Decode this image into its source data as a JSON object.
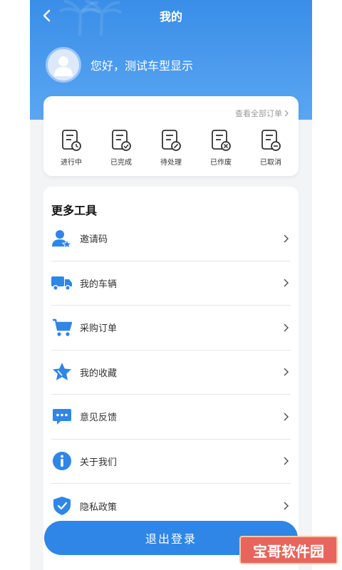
{
  "nav": {
    "title": "我的"
  },
  "profile": {
    "greeting": "您好，测试车型显示"
  },
  "orders": {
    "view_all": "查看全部订单",
    "items": [
      {
        "label": "进行中",
        "icon": "order-in-progress-icon"
      },
      {
        "label": "已完成",
        "icon": "order-completed-icon"
      },
      {
        "label": "待处理",
        "icon": "order-pending-icon"
      },
      {
        "label": "已作废",
        "icon": "order-voided-icon"
      },
      {
        "label": "已取消",
        "icon": "order-cancelled-icon"
      }
    ]
  },
  "tools": {
    "title": "更多工具",
    "items": [
      {
        "label": "邀请码",
        "icon": "invite-user-icon"
      },
      {
        "label": "我的车辆",
        "icon": "truck-icon"
      },
      {
        "label": "采购订单",
        "icon": "cart-icon"
      },
      {
        "label": "我的收藏",
        "icon": "star-icon"
      },
      {
        "label": "意见反馈",
        "icon": "feedback-icon"
      },
      {
        "label": "关于我们",
        "icon": "info-icon"
      },
      {
        "label": "隐私政策",
        "icon": "shield-check-icon"
      }
    ]
  },
  "logout": {
    "label": "退出登录"
  },
  "watermark": {
    "text": "宝哥软件园"
  },
  "colors": {
    "primary": "#2f86e6",
    "header_top": "#3a8ee8",
    "header_bottom": "#5aa6f2",
    "icon": "#2f86e6"
  }
}
